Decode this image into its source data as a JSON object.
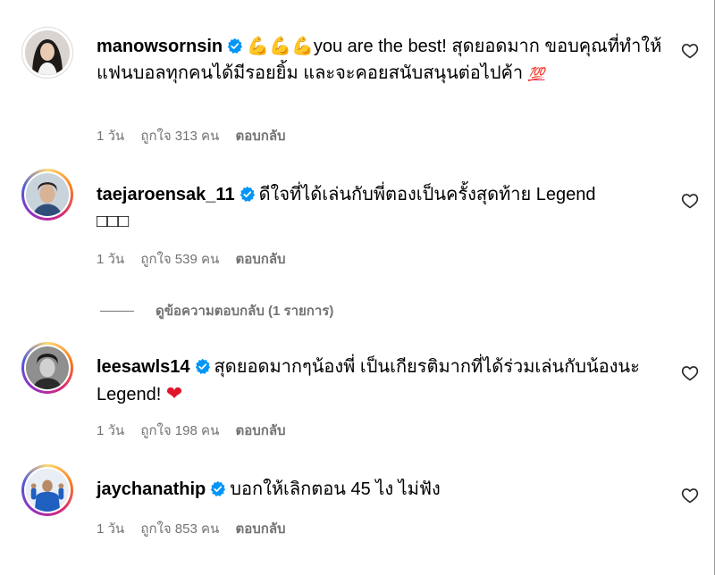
{
  "colors": {
    "verified": "#0095f6",
    "muted": "#737373",
    "heart_emoji": "#e0142b"
  },
  "comments": [
    {
      "username": "manowsornsin",
      "verified": true,
      "avatar": "woman-portrait",
      "story_ring": false,
      "text_emoji": "💪💪💪",
      "text": "you are the best! สุดยอดมาก ขอบคุณที่ทำให้แฟนบอลทุกคนได้มีรอยยิ้ม และจะคอยสนับสนุนต่อไปค้า",
      "text_end_emoji": "💯",
      "time": "1 วัน",
      "likes": "ถูกใจ 313 คน",
      "reply": "ตอบกลับ"
    },
    {
      "username": "taejaroensak_11",
      "verified": true,
      "avatar": "man-portrait",
      "story_ring": true,
      "text": "ดีใจที่ได้เล่นกับพี่ตองเป็นครั้งสุดท้าย Legend",
      "text_line2": "□□□",
      "time": "1 วัน",
      "likes": "ถูกใจ 539 คน",
      "reply": "ตอบกลับ"
    },
    {
      "username": "leesawls14",
      "verified": true,
      "avatar": "man-bw-portrait",
      "story_ring": true,
      "text": "สุดยอดมากๆน้องพี่ เป็นเกียรติมากที่ได้ร่วมเล่นกับน้องนะ Legend!",
      "text_end_emoji": "❤",
      "time": "1 วัน",
      "likes": "ถูกใจ 198 คน",
      "reply": "ตอบกลับ"
    },
    {
      "username": "jaychanathip",
      "verified": true,
      "avatar": "footballer-portrait",
      "story_ring": true,
      "text": "บอกให้เลิกตอน 45 ไง ไม่ฟัง",
      "time": "1 วัน",
      "likes": "ถูกใจ 853 คน",
      "reply": "ตอบกลับ"
    }
  ],
  "view_replies": "ดูข้อความตอบกลับ (1 รายการ)",
  "icons": {
    "verified": "verified-badge-icon",
    "like": "heart-outline-icon"
  }
}
